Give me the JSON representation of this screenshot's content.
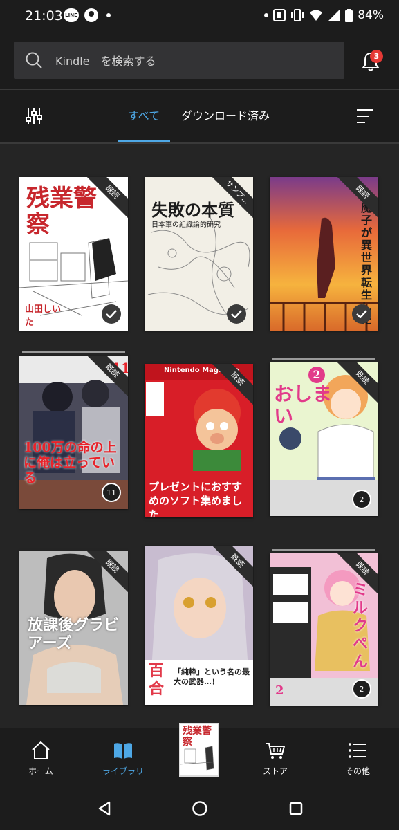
{
  "status_bar": {
    "time": "21:03",
    "line_icon": "LINE",
    "battery": "84%"
  },
  "search": {
    "placeholder": "Kindle　を検索する",
    "notification_count": "3"
  },
  "tabs": {
    "all": "すべて",
    "downloaded": "ダウンロード済み"
  },
  "books": [
    {
      "title": "残業警察",
      "author": "山田しいた",
      "ribbon": "既読",
      "badge": "check",
      "bg": "#ffffff"
    },
    {
      "title": "失敗の本質",
      "subtitle": "日本軍の組織論的研究",
      "ribbon": "サンプ...",
      "badge": "check",
      "bg": "#f2efe6"
    },
    {
      "title": "私、魔子が異世界転生したっぽ",
      "ribbon": "既読",
      "badge": "check",
      "bg": "#e8803a"
    },
    {
      "title": "100万の命の上に俺は立っている",
      "volume": "11",
      "ribbon": "既読",
      "badge": "11",
      "bg": "#3a3a48"
    },
    {
      "title": "プレゼントにおすすめのソフト集めました",
      "header": "Nintendo Magazine",
      "ribbon": "既読",
      "bg": "#d81e28"
    },
    {
      "title": "おしまい",
      "volume": "2",
      "ribbon": "既読",
      "badge": "2",
      "bg": "#8ccf7a"
    },
    {
      "title": "放課後グラビアーズ",
      "ribbon": "既読",
      "bg": "#cfcfcf"
    },
    {
      "title": "百合",
      "tagline": "「純粋」という名の最大の武器…！",
      "ribbon": "既読",
      "bg": "#b9a8c4"
    },
    {
      "title": "ミルクぺん",
      "volume": "2",
      "ribbon": "既読",
      "badge": "2",
      "bg": "#e04a8c"
    }
  ],
  "mini_cover": {
    "title": "残業警察"
  },
  "bottom_nav": {
    "home": "ホーム",
    "library": "ライブラリ",
    "store": "ストア",
    "more": "その他"
  }
}
